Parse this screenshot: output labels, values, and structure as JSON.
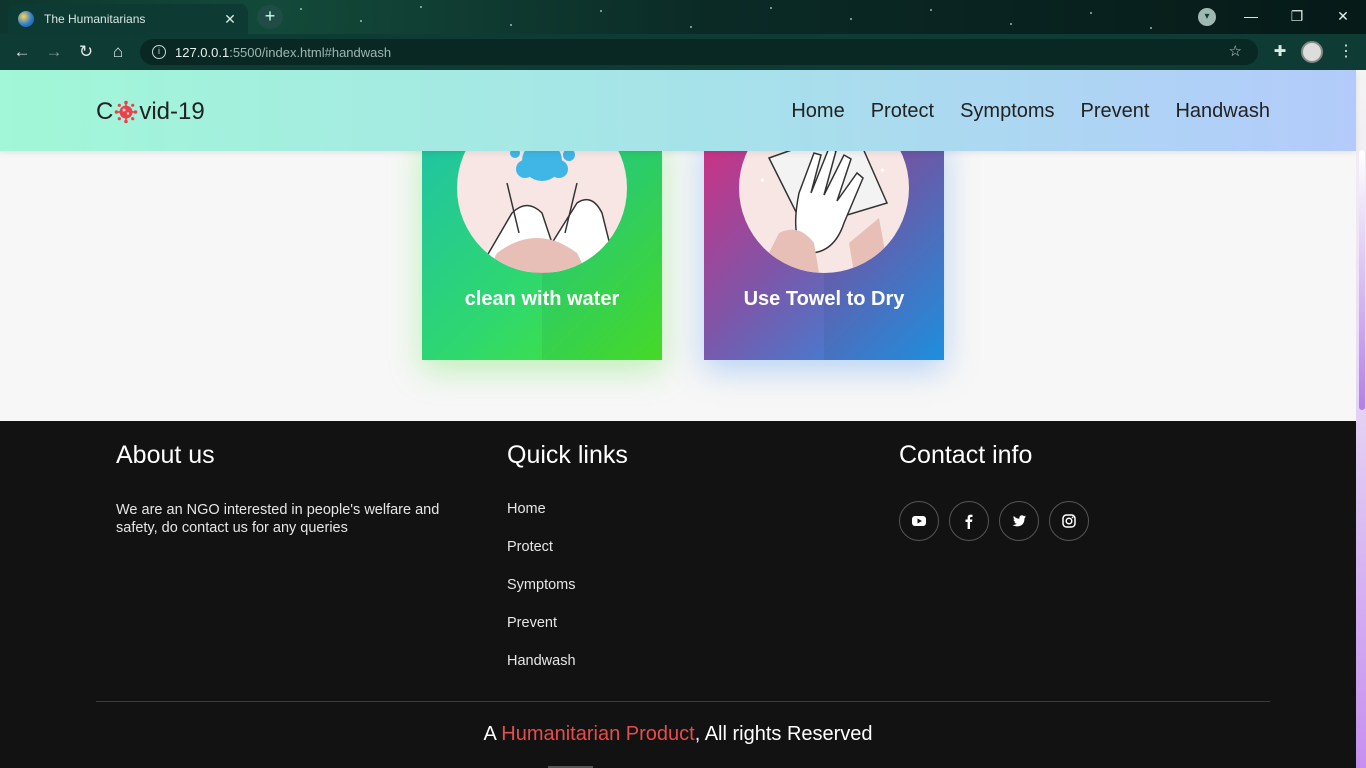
{
  "browser": {
    "tab_title": "The Humanitarians",
    "tab_close": "✕",
    "new_tab": "+",
    "url_host": "127.0.0.1",
    "url_rest": ":5500/index.html#handwash",
    "window_controls": [
      "—",
      "❐",
      "✕"
    ]
  },
  "site": {
    "logo_prefix": "C",
    "logo_suffix": "vid-19",
    "nav": [
      "Home",
      "Protect",
      "Symptoms",
      "Prevent",
      "Handwash"
    ]
  },
  "cards": [
    {
      "label": "clean with water",
      "icon": "washing-hands-icon"
    },
    {
      "label": "Use Towel to Dry",
      "icon": "towel-drying-icon"
    }
  ],
  "footer": {
    "about_title": "About us",
    "about_text": "We are an NGO interested in people's welfare and safety, do contact us for any queries",
    "links_title": "Quick links",
    "links": [
      "Home",
      "Protect",
      "Symptoms",
      "Prevent",
      "Handwash"
    ],
    "contact_title": "Contact info",
    "social": [
      "youtube-icon",
      "facebook-icon",
      "twitter-icon",
      "instagram-icon"
    ],
    "copyright_prefix": "A ",
    "copyright_brand": "Humanitarian Product",
    "copyright_suffix": ", All rights Reserved"
  },
  "colors": {
    "accent_red": "#e74c4c",
    "footer_bg": "#121212",
    "nav_gradient_start": "#a1f7d7",
    "nav_gradient_end": "#b3cbfb"
  }
}
